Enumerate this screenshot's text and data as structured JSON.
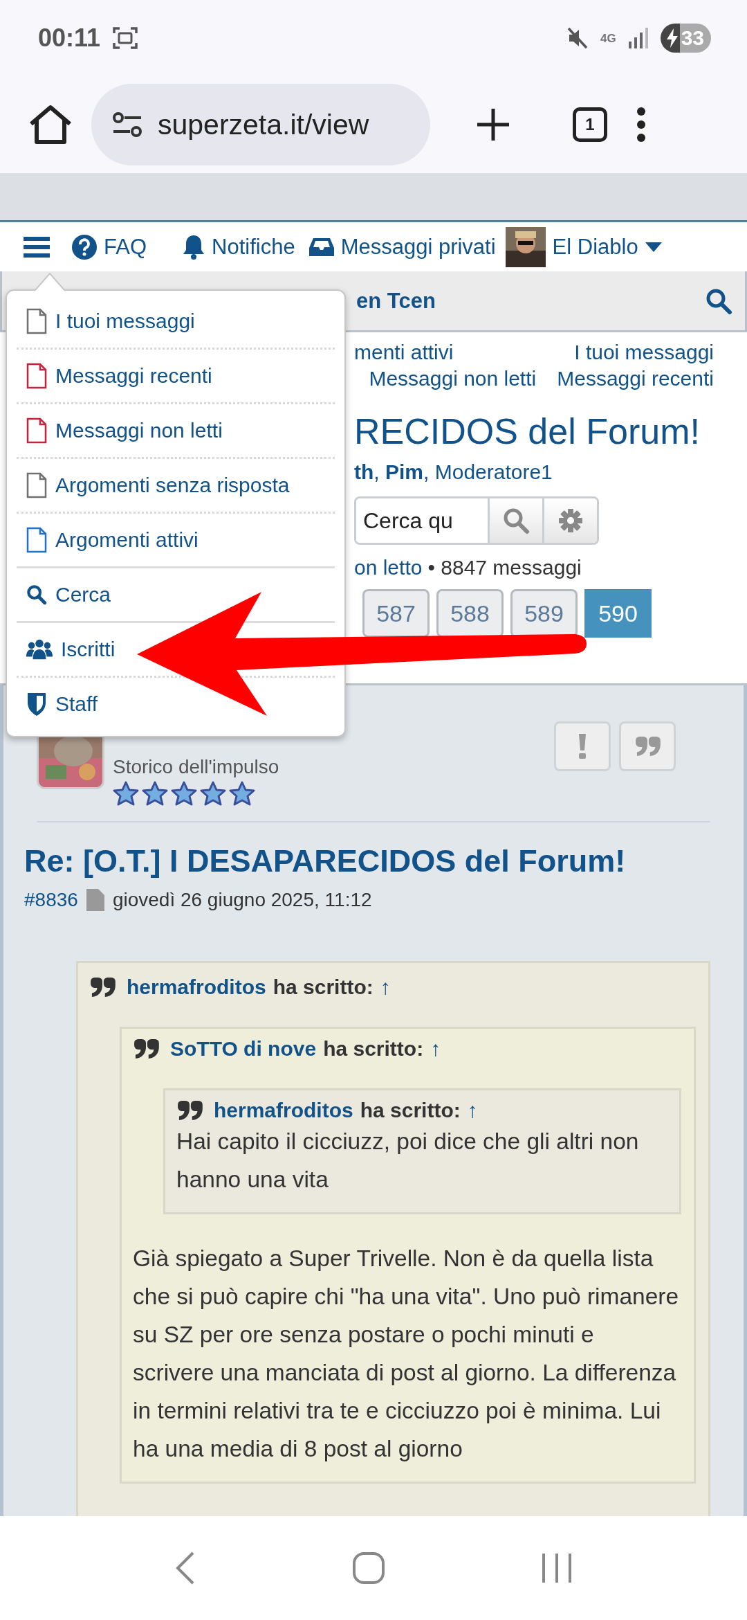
{
  "status_bar": {
    "time": "00:11",
    "network": "4G",
    "battery": "33"
  },
  "browser": {
    "url": "superzeta.it/view",
    "tab_count": "1"
  },
  "nav": {
    "faq": "FAQ",
    "notifications": "Notifiche",
    "messages": "Messaggi privati",
    "user": "El Diablo"
  },
  "menu": {
    "sections": [
      [
        {
          "label": "I tuoi messaggi",
          "kind": "document",
          "color": "#707070"
        },
        {
          "label": "Messaggi recenti",
          "kind": "document",
          "color": "#c8223f"
        },
        {
          "label": "Messaggi non letti",
          "kind": "document",
          "color": "#c8223f"
        },
        {
          "label": "Argomenti senza risposta",
          "kind": "document",
          "color": "#707070"
        },
        {
          "label": "Argomenti attivi",
          "kind": "document",
          "color": "#1f73c8"
        }
      ],
      [
        {
          "label": "Cerca",
          "kind": "search"
        }
      ],
      [
        {
          "label": "Iscritti",
          "kind": "users"
        },
        {
          "label": "Staff",
          "kind": "shield"
        }
      ]
    ]
  },
  "forum_header": {
    "title": "en Tcen"
  },
  "quick_links": [
    [
      "menti attivi",
      "I tuoi messaggi"
    ],
    [
      "Messaggi non letti",
      "Messaggi recenti"
    ]
  ],
  "topic": {
    "title": "RECIDOS del Forum!",
    "moderators": "**th**, **Pim**, Moderatore1",
    "search_placeholder": "Cerca qu",
    "unread_link": "on letto",
    "count": "• 8847 messaggi"
  },
  "pagination": [
    {
      "label": "587",
      "selected": false
    },
    {
      "label": "588",
      "selected": false
    },
    {
      "label": "589",
      "selected": false
    },
    {
      "label": "590",
      "selected": true
    }
  ],
  "post": {
    "rank": "Storico dell'impulso",
    "stars": 5,
    "title": "Re: [O.T.] I DESAPARECIDOS del Forum!",
    "number": "#8836",
    "date": "giovedì 26 giugno 2025, 11:12",
    "quote": {
      "author": "hermafroditos",
      "label": "ha scritto:",
      "link": "↑",
      "children": [
        {
          "author": "SoTTO di nove",
          "label": "ha scritto:",
          "link": "↑",
          "children": [
            {
              "author": "hermafroditos",
              "label": "ha scritto:",
              "link": "↑",
              "text": "Hai capito il cicciuzz, poi dice che gli altri non hanno una vita"
            }
          ],
          "text": "Già spiegato a Super Trivelle. Non è da quella lista che si può capire chi \"ha una vita\". Uno può rimanere su SZ per ore senza postare o pochi minuti e scrivere una manciata di post al giorno. La differenza in termini relativi tra te e cicciuzzo poi è minima. Lui ha una media di 8 post al giorno"
        }
      ]
    }
  }
}
